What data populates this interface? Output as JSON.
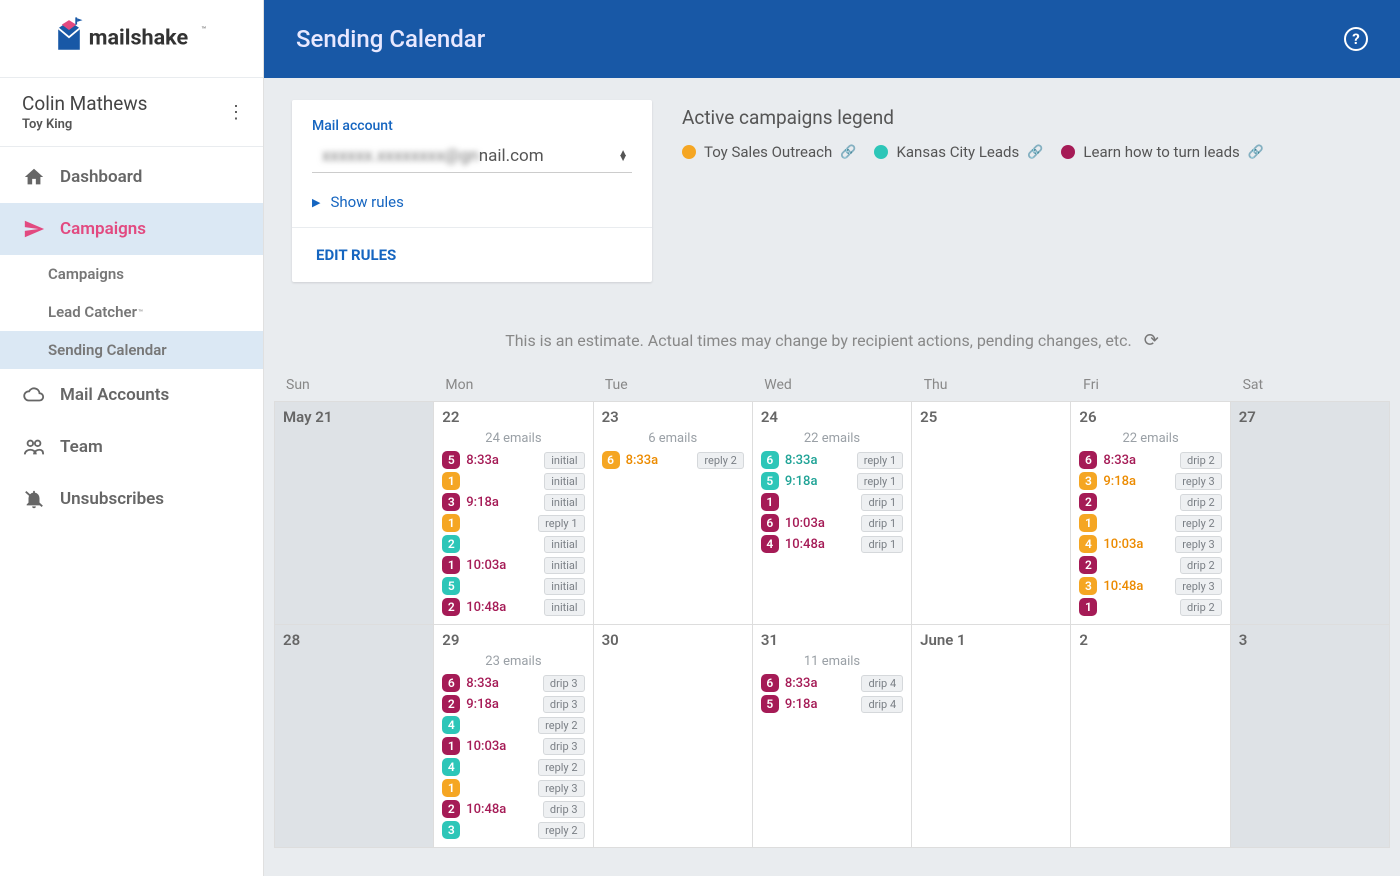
{
  "brand": {
    "name": "mailshake",
    "tm": "™"
  },
  "user": {
    "name": "Colin Mathews",
    "team": "Toy King"
  },
  "sidebar": {
    "items": [
      {
        "label": "Dashboard"
      },
      {
        "label": "Campaigns"
      },
      {
        "label": "Mail Accounts"
      },
      {
        "label": "Team"
      },
      {
        "label": "Unsubscribes"
      }
    ],
    "sub": [
      {
        "label": "Campaigns"
      },
      {
        "label": "Lead Catcher",
        "tm": true
      },
      {
        "label": "Sending Calendar"
      }
    ]
  },
  "header": {
    "title": "Sending Calendar"
  },
  "card": {
    "label": "Mail account",
    "account_visible": "nail.com",
    "account_hidden": "xxxxxx.xxxxxxxx@gn",
    "show_rules": "Show rules",
    "edit_rules": "EDIT RULES"
  },
  "legend": {
    "title": "Active campaigns legend",
    "items": [
      {
        "label": "Toy Sales Outreach",
        "color": "orange"
      },
      {
        "label": "Kansas City Leads",
        "color": "teal"
      },
      {
        "label": "Learn how to turn leads",
        "color": "magenta"
      }
    ]
  },
  "estimate_note": "This is an estimate. Actual times may change by recipient actions, pending changes, etc.",
  "days": [
    "Sun",
    "Mon",
    "Tue",
    "Wed",
    "Thu",
    "Fri",
    "Sat"
  ],
  "cells": [
    {
      "date": "May  21",
      "weekend": true,
      "events": []
    },
    {
      "date": "22",
      "count": "24 emails",
      "events": [
        {
          "n": "5",
          "color": "magenta",
          "time": "8:33a",
          "chip": "initial"
        },
        {
          "n": "1",
          "color": "orange",
          "chip": "initial"
        },
        {
          "n": "3",
          "color": "magenta",
          "time": "9:18a",
          "chip": "initial"
        },
        {
          "n": "1",
          "color": "orange",
          "chip": "reply 1"
        },
        {
          "n": "2",
          "color": "teal",
          "chip": "initial"
        },
        {
          "n": "1",
          "color": "magenta",
          "time": "10:03a",
          "chip": "initial"
        },
        {
          "n": "5",
          "color": "teal",
          "chip": "initial"
        },
        {
          "n": "2",
          "color": "magenta",
          "time": "10:48a",
          "chip": "initial"
        }
      ]
    },
    {
      "date": "23",
      "count": "6 emails",
      "events": [
        {
          "n": "6",
          "color": "orange",
          "time": "8:33a",
          "chip": "reply 2"
        }
      ]
    },
    {
      "date": "24",
      "count": "22 emails",
      "events": [
        {
          "n": "6",
          "color": "teal",
          "time": "8:33a",
          "chip": "reply 1"
        },
        {
          "n": "5",
          "color": "teal",
          "time": "9:18a",
          "chip": "reply 1"
        },
        {
          "n": "1",
          "color": "magenta",
          "chip": "drip 1"
        },
        {
          "n": "6",
          "color": "magenta",
          "time": "10:03a",
          "chip": "drip 1"
        },
        {
          "n": "4",
          "color": "magenta",
          "time": "10:48a",
          "chip": "drip 1"
        }
      ]
    },
    {
      "date": "25",
      "events": []
    },
    {
      "date": "26",
      "count": "22 emails",
      "events": [
        {
          "n": "6",
          "color": "magenta",
          "time": "8:33a",
          "chip": "drip 2"
        },
        {
          "n": "3",
          "color": "orange",
          "time": "9:18a",
          "chip": "reply 3"
        },
        {
          "n": "2",
          "color": "magenta",
          "chip": "drip 2"
        },
        {
          "n": "1",
          "color": "orange",
          "chip": "reply 2"
        },
        {
          "n": "4",
          "color": "orange",
          "time": "10:03a",
          "chip": "reply 3"
        },
        {
          "n": "2",
          "color": "magenta",
          "chip": "drip 2"
        },
        {
          "n": "3",
          "color": "orange",
          "time": "10:48a",
          "chip": "reply 3"
        },
        {
          "n": "1",
          "color": "magenta",
          "chip": "drip 2"
        }
      ]
    },
    {
      "date": "27",
      "weekend": true,
      "events": []
    },
    {
      "date": "28",
      "weekend": true,
      "events": []
    },
    {
      "date": "29",
      "count": "23 emails",
      "events": [
        {
          "n": "6",
          "color": "magenta",
          "time": "8:33a",
          "chip": "drip 3"
        },
        {
          "n": "2",
          "color": "magenta",
          "time": "9:18a",
          "chip": "drip 3"
        },
        {
          "n": "4",
          "color": "teal",
          "chip": "reply 2"
        },
        {
          "n": "1",
          "color": "magenta",
          "time": "10:03a",
          "chip": "drip 3"
        },
        {
          "n": "4",
          "color": "teal",
          "chip": "reply 2"
        },
        {
          "n": "1",
          "color": "orange",
          "chip": "reply 3"
        },
        {
          "n": "2",
          "color": "magenta",
          "time": "10:48a",
          "chip": "drip 3"
        },
        {
          "n": "3",
          "color": "teal",
          "chip": "reply 2"
        }
      ]
    },
    {
      "date": "30",
      "events": []
    },
    {
      "date": "31",
      "count": "11 emails",
      "events": [
        {
          "n": "6",
          "color": "magenta",
          "time": "8:33a",
          "chip": "drip 4"
        },
        {
          "n": "5",
          "color": "magenta",
          "time": "9:18a",
          "chip": "drip 4"
        }
      ]
    },
    {
      "date": "June  1",
      "events": []
    },
    {
      "date": "2",
      "events": []
    },
    {
      "date": "3",
      "weekend": true,
      "events": []
    }
  ]
}
